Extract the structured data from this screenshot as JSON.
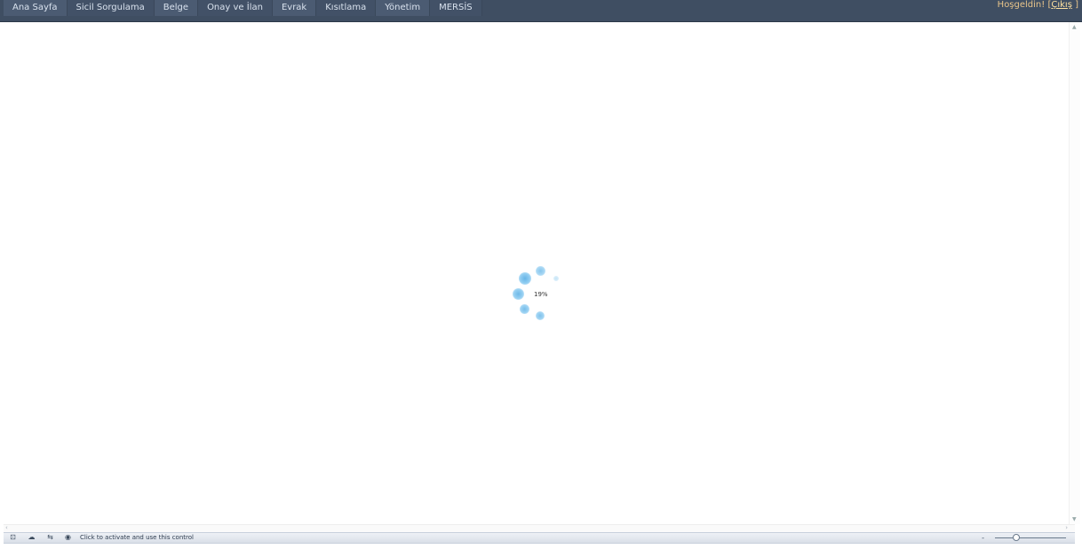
{
  "nav": {
    "items": [
      "Ana Sayfa",
      "Sicil Sorgulama",
      "Belge",
      "Onay ve İlan",
      "Evrak",
      "Kısıtlama",
      "Yönetim",
      "MERSİS"
    ]
  },
  "header": {
    "welcome": "Hoşgeldin! [",
    "logout": "Çıkış",
    "close_bracket": " ]"
  },
  "loader": {
    "percent_text": "19%",
    "progress": 0.19,
    "color": "#5fb2e6"
  },
  "statusbar": {
    "message": "Click to activate and use this control",
    "zoom_minus": "-",
    "zoom_level": 0.3
  },
  "colors": {
    "topbar": "#3f4e62",
    "nav_text": "#d9e2ee",
    "welcome_text": "#e8c48a"
  }
}
